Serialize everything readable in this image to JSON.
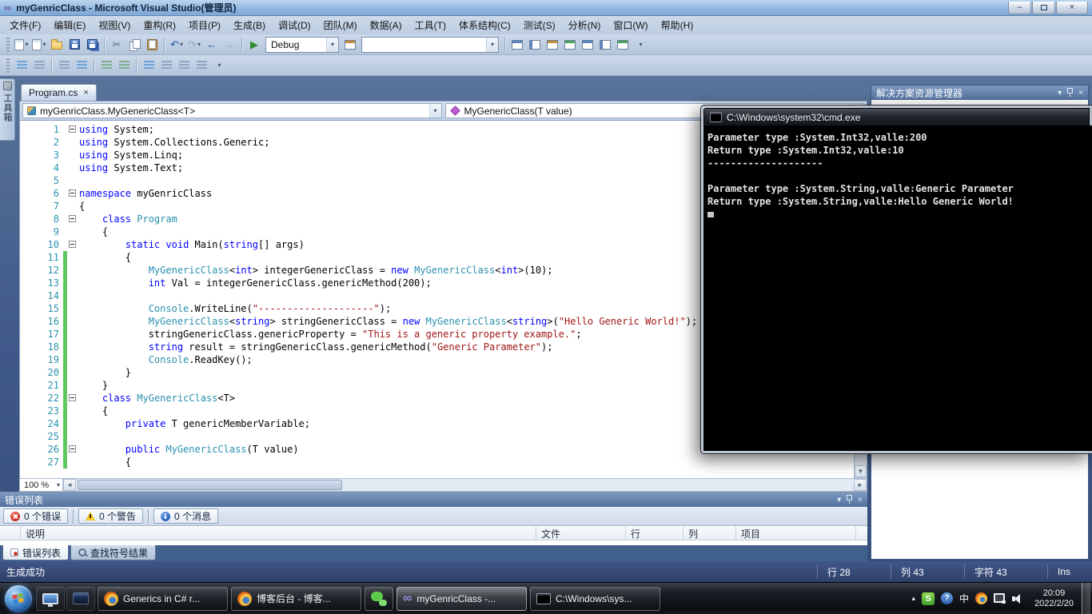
{
  "icons": {
    "dropdown": "▾",
    "close": "×",
    "play": "▶",
    "undo": "↶",
    "redo": "↷",
    "back": "←",
    "forward": "→",
    "cut": "✂",
    "left": "◄",
    "right": "►",
    "up": "▲",
    "down": "▼",
    "vs": "∞",
    "expand": "▴",
    "min": "–",
    "help": "?",
    "sogou": "S"
  },
  "window": {
    "title": "myGenricClass - Microsoft Visual Studio(管理员)"
  },
  "menu": {
    "items": [
      "文件(F)",
      "编辑(E)",
      "视图(V)",
      "重构(R)",
      "项目(P)",
      "生成(B)",
      "调试(D)",
      "团队(M)",
      "数据(A)",
      "工具(T)",
      "体系结构(C)",
      "测试(S)",
      "分析(N)",
      "窗口(W)",
      "帮助(H)"
    ]
  },
  "toolbar": {
    "debug_label": "Debug",
    "find_value": ""
  },
  "toolbox": {
    "label": "工具箱"
  },
  "editor": {
    "tab_label": "Program.cs",
    "type_nav": "myGenricClass.MyGenericClass<T>",
    "member_nav": "MyGenericClass(T value)",
    "zoom": "100 %",
    "lines": [
      {
        "n": 1,
        "fold": 1,
        "segs": [
          [
            "k",
            "using"
          ],
          [
            "p",
            " System;"
          ]
        ]
      },
      {
        "n": 2,
        "segs": [
          [
            "k",
            "using"
          ],
          [
            "p",
            " System.Collections.Generic;"
          ]
        ]
      },
      {
        "n": 3,
        "segs": [
          [
            "k",
            "using"
          ],
          [
            "p",
            " System.Linq;"
          ]
        ]
      },
      {
        "n": 4,
        "segs": [
          [
            "k",
            "using"
          ],
          [
            "p",
            " System.Text;"
          ]
        ]
      },
      {
        "n": 5,
        "segs": []
      },
      {
        "n": 6,
        "fold": 1,
        "segs": [
          [
            "k",
            "namespace"
          ],
          [
            "p",
            " myGenricClass"
          ]
        ]
      },
      {
        "n": 7,
        "segs": [
          [
            "p",
            "{"
          ]
        ]
      },
      {
        "n": 8,
        "fold": 1,
        "segs": [
          [
            "p",
            "    "
          ],
          [
            "k",
            "class"
          ],
          [
            "t",
            " Program"
          ]
        ]
      },
      {
        "n": 9,
        "segs": [
          [
            "p",
            "    {"
          ]
        ]
      },
      {
        "n": 10,
        "fold": 1,
        "segs": [
          [
            "p",
            "        "
          ],
          [
            "k",
            "static"
          ],
          [
            "p",
            " "
          ],
          [
            "k",
            "void"
          ],
          [
            "p",
            " Main("
          ],
          [
            "k",
            "string"
          ],
          [
            "p",
            "[] args)"
          ]
        ]
      },
      {
        "n": 11,
        "chg": 1,
        "segs": [
          [
            "p",
            "        {"
          ]
        ]
      },
      {
        "n": 12,
        "chg": 1,
        "segs": [
          [
            "p",
            "            "
          ],
          [
            "t",
            "MyGenericClass"
          ],
          [
            "p",
            "<"
          ],
          [
            "k",
            "int"
          ],
          [
            "p",
            "> integerGenericClass = "
          ],
          [
            "k",
            "new"
          ],
          [
            "p",
            " "
          ],
          [
            "t",
            "MyGenericClass"
          ],
          [
            "p",
            "<"
          ],
          [
            "k",
            "int"
          ],
          [
            "p",
            ">(10);"
          ]
        ]
      },
      {
        "n": 13,
        "chg": 1,
        "segs": [
          [
            "p",
            "            "
          ],
          [
            "k",
            "int"
          ],
          [
            "p",
            " Val = integerGenericClass.genericMethod(200);"
          ]
        ]
      },
      {
        "n": 14,
        "chg": 1,
        "segs": []
      },
      {
        "n": 15,
        "chg": 1,
        "segs": [
          [
            "p",
            "            "
          ],
          [
            "t",
            "Console"
          ],
          [
            "p",
            ".WriteLine("
          ],
          [
            "s",
            "\"--------------------\""
          ],
          [
            "p",
            ");"
          ]
        ]
      },
      {
        "n": 16,
        "chg": 1,
        "segs": [
          [
            "p",
            "            "
          ],
          [
            "t",
            "MyGenericClass"
          ],
          [
            "p",
            "<"
          ],
          [
            "k",
            "string"
          ],
          [
            "p",
            "> stringGenericClass = "
          ],
          [
            "k",
            "new"
          ],
          [
            "p",
            " "
          ],
          [
            "t",
            "MyGenericClass"
          ],
          [
            "p",
            "<"
          ],
          [
            "k",
            "string"
          ],
          [
            "p",
            ">("
          ],
          [
            "s",
            "\"Hello Generic World!\""
          ],
          [
            "p",
            ");"
          ]
        ]
      },
      {
        "n": 17,
        "chg": 1,
        "segs": [
          [
            "p",
            "            stringGenericClass.genericProperty = "
          ],
          [
            "s",
            "\"This is a generic property example.\""
          ],
          [
            "p",
            ";"
          ]
        ]
      },
      {
        "n": 18,
        "chg": 1,
        "segs": [
          [
            "p",
            "            "
          ],
          [
            "k",
            "string"
          ],
          [
            "p",
            " result = stringGenericClass.genericMethod("
          ],
          [
            "s",
            "\"Generic Parameter\""
          ],
          [
            "p",
            ");"
          ]
        ]
      },
      {
        "n": 19,
        "chg": 1,
        "segs": [
          [
            "p",
            "            "
          ],
          [
            "t",
            "Console"
          ],
          [
            "p",
            ".ReadKey();"
          ]
        ]
      },
      {
        "n": 20,
        "chg": 1,
        "segs": [
          [
            "p",
            "        }"
          ]
        ]
      },
      {
        "n": 21,
        "chg": 1,
        "segs": [
          [
            "p",
            "    }"
          ]
        ]
      },
      {
        "n": 22,
        "chg": 1,
        "fold": 1,
        "segs": [
          [
            "p",
            "    "
          ],
          [
            "k",
            "class"
          ],
          [
            "p",
            " "
          ],
          [
            "t",
            "MyGenericClass"
          ],
          [
            "p",
            "<T>"
          ]
        ]
      },
      {
        "n": 23,
        "chg": 1,
        "segs": [
          [
            "p",
            "    {"
          ]
        ]
      },
      {
        "n": 24,
        "chg": 1,
        "segs": [
          [
            "p",
            "        "
          ],
          [
            "k",
            "private"
          ],
          [
            "p",
            " T genericMemberVariable;"
          ]
        ]
      },
      {
        "n": 25,
        "chg": 1,
        "segs": []
      },
      {
        "n": 26,
        "chg": 1,
        "fold": 1,
        "segs": [
          [
            "p",
            "        "
          ],
          [
            "k",
            "public"
          ],
          [
            "p",
            " "
          ],
          [
            "t",
            "MyGenericClass"
          ],
          [
            "p",
            "(T value)"
          ]
        ]
      },
      {
        "n": 27,
        "chg": 1,
        "segs": [
          [
            "p",
            "        {"
          ]
        ]
      }
    ]
  },
  "cmd": {
    "title": "C:\\Windows\\system32\\cmd.exe",
    "lines": [
      "Parameter type :System.Int32,valle:200",
      "Return type :System.Int32,valle:10",
      "--------------------",
      "",
      "Parameter type :System.String,valle:Generic Parameter",
      "Return type :System.String,valle:Hello Generic World!"
    ]
  },
  "solution_explorer": {
    "title": "解决方案资源管理器"
  },
  "error_list": {
    "title": "错误列表",
    "filters": [
      "0 个错误",
      "0 个警告",
      "0 个消息"
    ],
    "columns": [
      "说明",
      "文件",
      "行",
      "列",
      "项目"
    ],
    "tabs": [
      "错误列表",
      "查找符号结果"
    ]
  },
  "status": {
    "message": "生成成功",
    "line": "行 28",
    "col": "列 43",
    "char": "字符 43",
    "mode": "Ins"
  },
  "taskbar": {
    "buttons": [
      {
        "label": "Generics in C# r..."
      },
      {
        "label": "博客后台 - 博客..."
      },
      {
        "label": ""
      },
      {
        "label": "myGenricClass -..."
      },
      {
        "label": "C:\\Windows\\sys..."
      }
    ],
    "tray": {
      "ime": "中",
      "time": "20:09",
      "date": "2022/2/20"
    }
  }
}
